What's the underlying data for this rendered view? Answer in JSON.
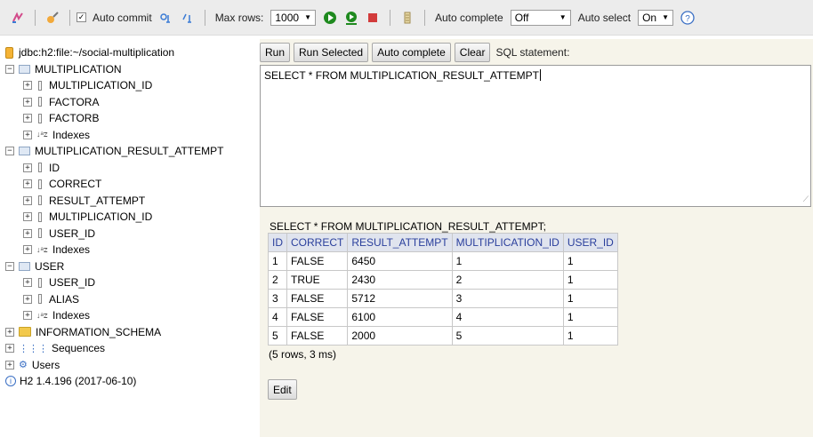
{
  "toolbar": {
    "auto_commit_label": "Auto commit",
    "auto_commit_checked": true,
    "max_rows_label": "Max rows:",
    "max_rows_value": "1000",
    "auto_complete_label": "Auto complete",
    "auto_complete_value": "Off",
    "auto_select_label": "Auto select",
    "auto_select_value": "On",
    "help_glyph": "?",
    "run_color": "#1f8a1f",
    "stop_color": "#d23b3b"
  },
  "tree": {
    "connection": "jdbc:h2:file:~/social-multiplication",
    "tables": [
      {
        "name": "MULTIPLICATION",
        "columns": [
          "MULTIPLICATION_ID",
          "FACTORA",
          "FACTORB"
        ],
        "indexes_label": "Indexes"
      },
      {
        "name": "MULTIPLICATION_RESULT_ATTEMPT",
        "columns": [
          "ID",
          "CORRECT",
          "RESULT_ATTEMPT",
          "MULTIPLICATION_ID",
          "USER_ID"
        ],
        "indexes_label": "Indexes"
      },
      {
        "name": "USER",
        "columns": [
          "USER_ID",
          "ALIAS"
        ],
        "indexes_label": "Indexes"
      }
    ],
    "schema": "INFORMATION_SCHEMA",
    "sequences": "Sequences",
    "users": "Users",
    "version": "H2 1.4.196 (2017-06-10)"
  },
  "buttons": {
    "run": "Run",
    "run_selected": "Run Selected",
    "auto_complete": "Auto complete",
    "clear": "Clear",
    "sql_statement_label": "SQL statement:"
  },
  "editor": {
    "sql": "SELECT * FROM MULTIPLICATION_RESULT_ATTEMPT"
  },
  "result": {
    "query": "SELECT * FROM MULTIPLICATION_RESULT_ATTEMPT;",
    "headers": [
      "ID",
      "CORRECT",
      "RESULT_ATTEMPT",
      "MULTIPLICATION_ID",
      "USER_ID"
    ],
    "rows": [
      [
        "1",
        "FALSE",
        "6450",
        "1",
        "1"
      ],
      [
        "2",
        "TRUE",
        "2430",
        "2",
        "1"
      ],
      [
        "3",
        "FALSE",
        "5712",
        "3",
        "1"
      ],
      [
        "4",
        "FALSE",
        "6100",
        "4",
        "1"
      ],
      [
        "5",
        "FALSE",
        "2000",
        "5",
        "1"
      ]
    ],
    "row_count": "(5 rows, 3 ms)",
    "edit_label": "Edit"
  }
}
